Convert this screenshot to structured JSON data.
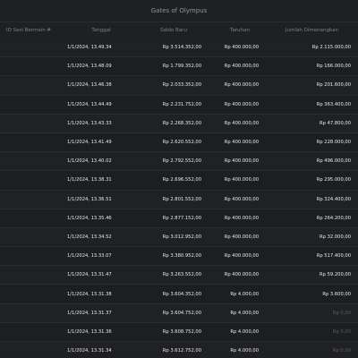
{
  "window": {
    "title": "Gates of Olympus"
  },
  "columns": {
    "id": "ID Sesi Bermain #",
    "date": "Tanggal",
    "balance": "Saldo Baru",
    "bet": "Taruhan",
    "win": "Jumlah Dimenangkan"
  },
  "rows": [
    {
      "id": "",
      "date": "1/1/2024, 13.49.34",
      "balance": "Rp 3.514.352,00",
      "bet": "Rp 400.000,00",
      "win": "Rp 2.115.000,00"
    },
    {
      "id": "",
      "date": "1/1/2024, 13.48.09",
      "balance": "Rp 1.799.352,00",
      "bet": "Rp 400.000,00",
      "win": "Rp 166.000,00"
    },
    {
      "id": "",
      "date": "1/1/2024, 13.46.38",
      "balance": "Rp 2.033.352,00",
      "bet": "Rp 400.000,00",
      "win": "Rp 201.600,00"
    },
    {
      "id": "",
      "date": "1/1/2024, 13.44.49",
      "balance": "Rp 2.231.752,00",
      "bet": "Rp 400.000,00",
      "win": "Rp 363.400,00"
    },
    {
      "id": "",
      "date": "1/1/2024, 13.43.33",
      "balance": "Rp 2.268.352,00",
      "bet": "Rp 400.000,00",
      "win": "Rp 47.800,00"
    },
    {
      "id": "",
      "date": "1/1/2024, 13.41.49",
      "balance": "Rp 2.620.552,00",
      "bet": "Rp 400.000,00",
      "win": "Rp 228.000,00"
    },
    {
      "id": "",
      "date": "1/1/2024, 13.40.02",
      "balance": "Rp 2.792.552,00",
      "bet": "Rp 400.000,00",
      "win": "Rp 496.000,00"
    },
    {
      "id": "",
      "date": "1/1/2024, 13.38.31",
      "balance": "Rp 2.696.552,00",
      "bet": "Rp 400.000,00",
      "win": "Rp 295.000,00"
    },
    {
      "id": "",
      "date": "1/1/2024, 13.36.51",
      "balance": "Rp 2.801.552,00",
      "bet": "Rp 400.000,00",
      "win": "Rp 324.400,00"
    },
    {
      "id": "",
      "date": "1/1/2024, 13.35.46",
      "balance": "Rp 2.877.152,00",
      "bet": "Rp 400.000,00",
      "win": "Rp 264.200,00"
    },
    {
      "id": "",
      "date": "1/1/2024, 13.34.52",
      "balance": "Rp 3.012.952,00",
      "bet": "Rp 400.000,00",
      "win": "Rp 32.000,00"
    },
    {
      "id": "",
      "date": "1/1/2024, 13.33.07",
      "balance": "Rp 3.380.952,00",
      "bet": "Rp 400.000,00",
      "win": "Rp 517.400,00"
    },
    {
      "id": "",
      "date": "1/1/2024, 13.31.47",
      "balance": "Rp 3.263.552,00",
      "bet": "Rp 400.000,00",
      "win": "Rp 59.200,00"
    },
    {
      "id": "",
      "date": "1/1/2024, 13.31.38",
      "balance": "Rp 3.604.352,00",
      "bet": "Rp 4.000,00",
      "win": "Rp 3.600,00"
    },
    {
      "id": "",
      "date": "1/1/2024, 13.31.37",
      "balance": "Rp 3.604.752,00",
      "bet": "Rp 4.000,00",
      "win": "Rp 0,00",
      "win_zero": true
    },
    {
      "id": "",
      "date": "1/1/2024, 13.31.36",
      "balance": "Rp 3.608.752,00",
      "bet": "Rp 4.000,00",
      "win": "Rp 0,00",
      "win_zero": true
    },
    {
      "id": "",
      "date": "1/1/2024, 13.31.34",
      "balance": "Rp 3.612.752,00",
      "bet": "Rp 4.000,00",
      "win": "Rp 0,00",
      "win_zero": true
    }
  ],
  "colors": {
    "background": "#1f2022",
    "text": "#e8e9ea",
    "muted": "#5c5f64",
    "divider": "#2b2c30"
  }
}
